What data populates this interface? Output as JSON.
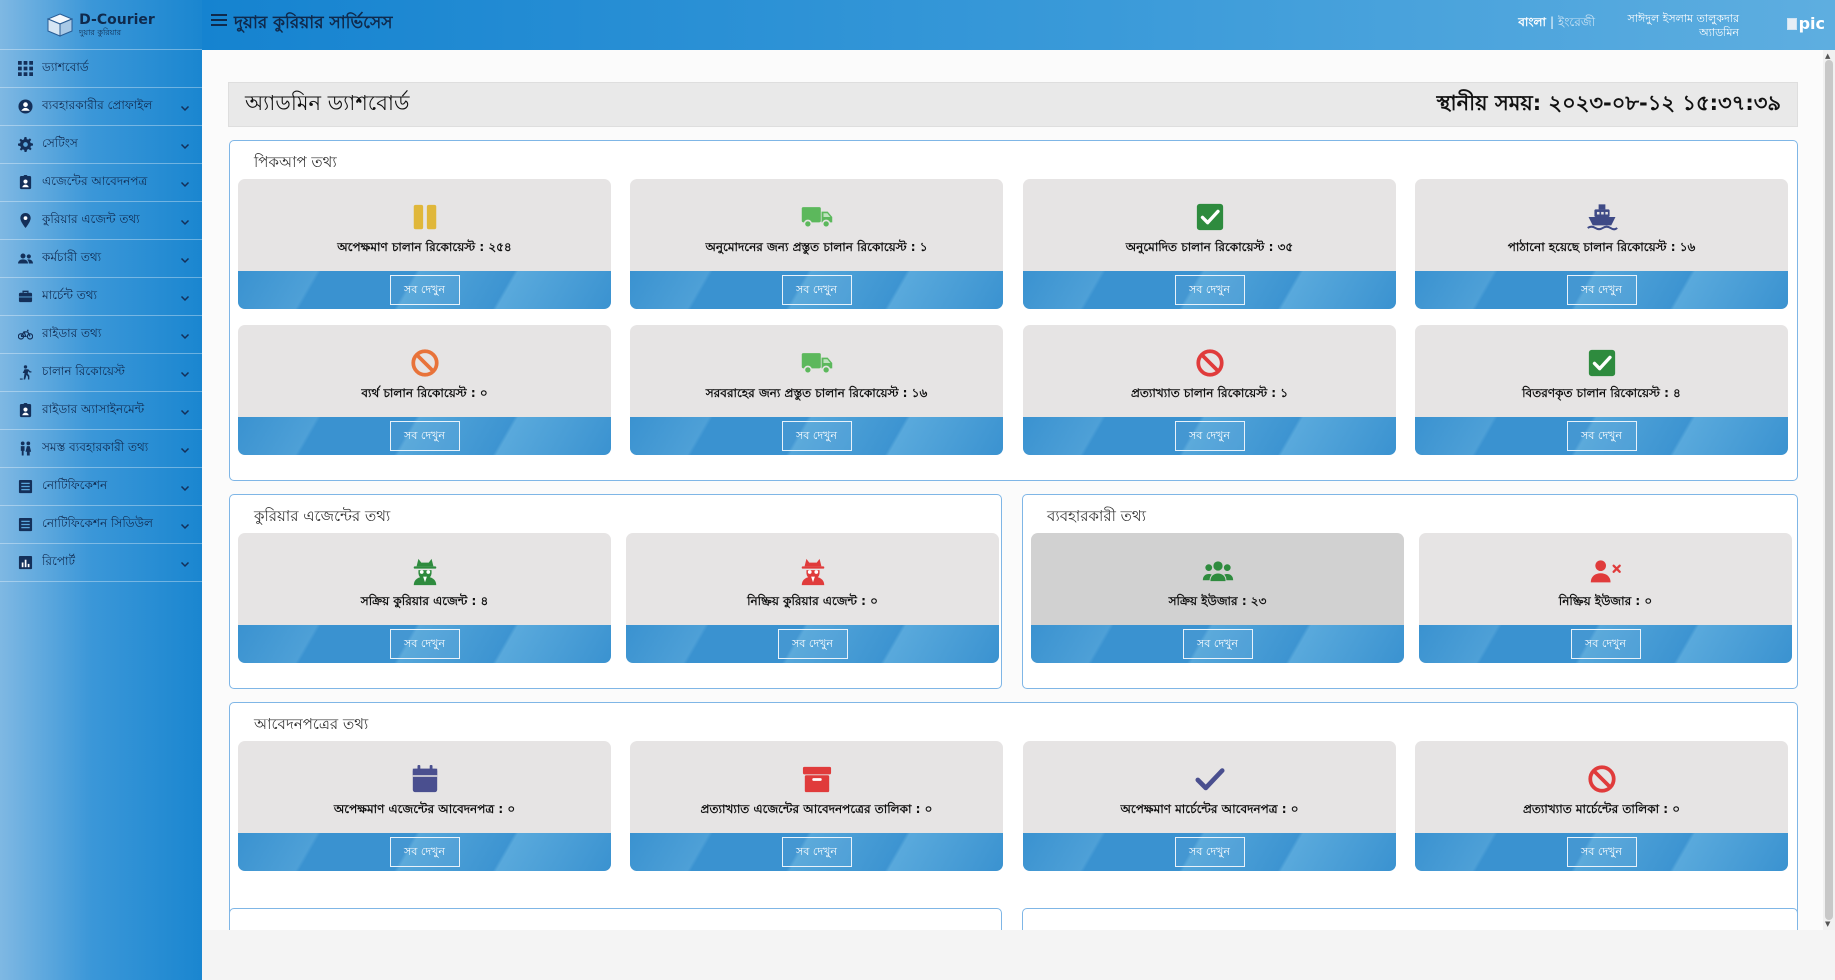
{
  "app": {
    "logo_title": "D-Courier",
    "logo_subtitle": "দুয়ার কুরিয়ার",
    "title": "দুয়ার কুরিয়ার সার্ভিসেস"
  },
  "header": {
    "lang_bn": "বাংলা",
    "lang_sep": "|",
    "lang_en": "ইংরেজী",
    "user_name": "সাঈদুল ইসলাম তালুকদার",
    "user_role": "অ্যাডমিন",
    "user_pic_alt": "pic"
  },
  "sidebar": {
    "items": [
      {
        "label": "ড্যাশবোর্ড",
        "icon": "grid-icon",
        "expandable": false
      },
      {
        "label": "ব্যবহারকারীর প্রোফাইল",
        "icon": "user-circle-icon",
        "expandable": true
      },
      {
        "label": "সেটিংস",
        "icon": "gear-icon",
        "expandable": true
      },
      {
        "label": "এজেন্টের আবেদনপত্র",
        "icon": "id-badge-icon",
        "expandable": true
      },
      {
        "label": "কুরিয়ার এজেন্ট তথ্য",
        "icon": "map-pin-icon",
        "expandable": true
      },
      {
        "label": "কর্মচারী তথ্য",
        "icon": "users-icon",
        "expandable": true
      },
      {
        "label": "মার্চেন্ট তথ্য",
        "icon": "briefcase-icon",
        "expandable": true
      },
      {
        "label": "রাইডার তথ্য",
        "icon": "bicycle-icon",
        "expandable": true
      },
      {
        "label": "চালান রিকোয়েস্ট",
        "icon": "walking-person-icon",
        "expandable": true
      },
      {
        "label": "রাইডার অ্যাসাইনমেন্ট",
        "icon": "id-badge-icon",
        "expandable": true
      },
      {
        "label": "সমস্ত ব্যবহারকারী তথ্য",
        "icon": "people-icon",
        "expandable": true
      },
      {
        "label": "নোটিফিকেশন",
        "icon": "list-icon",
        "expandable": true
      },
      {
        "label": "নোটিফিকেশন সিডিউল",
        "icon": "list-icon",
        "expandable": true
      },
      {
        "label": "রিপোর্ট",
        "icon": "bar-chart-icon",
        "expandable": true
      }
    ]
  },
  "page": {
    "title": "অ্যাডমিন ড্যাশবোর্ড",
    "local_time": "স্থানীয় সময়: ২০২৩-০৮-১২ ১৫:৩৭:৩৯"
  },
  "view_all_label": "সব দেখুন",
  "pickup": {
    "title": "পিকআপ তথ্য",
    "cards": [
      {
        "label": "অপেক্ষমাণ চালান রিকোয়েস্ট : ২৫৪",
        "icon": "pause-icon",
        "color": "#e0b73a"
      },
      {
        "label": "অনুমোদনের জন্য প্রস্তুত চালান রিকোয়েস্ট : ১",
        "icon": "truck-icon",
        "color": "#5cb85c"
      },
      {
        "label": "অনুমোদিত চালান রিকোয়েস্ট : ৩৫",
        "icon": "check-square-icon",
        "color": "#2e8b3e"
      },
      {
        "label": "পাঠানো হয়েছে চালান রিকোয়েস্ট : ১৬",
        "icon": "ship-icon",
        "color": "#3f4a86"
      },
      {
        "label": "ব্যর্থ চালান রিকোয়েস্ট : ০",
        "icon": "ban-icon",
        "color": "#e8733a"
      },
      {
        "label": "সরবরাহের জন্য প্রস্তুত চালান রিকোয়েস্ট : ১৬",
        "icon": "truck-icon",
        "color": "#5cb85c"
      },
      {
        "label": "প্রত্যাখ্যাত চালান রিকোয়েস্ট : ১",
        "icon": "ban-icon",
        "color": "#e03b3b"
      },
      {
        "label": "বিতরণকৃত চালান রিকোয়েস্ট : ৪",
        "icon": "check-square-icon",
        "color": "#2e8b3e"
      }
    ]
  },
  "agents": {
    "title": "কুরিয়ার এজেন্টের তথ্য",
    "cards": [
      {
        "label": "সক্রিয় কুরিয়ার এজেন্ট : ৪",
        "icon": "spy-icon",
        "color": "#2e8b3e"
      },
      {
        "label": "নিষ্ক্রিয় কুরিয়ার এজেন্ট : ০",
        "icon": "spy-icon",
        "color": "#e03b3b"
      }
    ]
  },
  "users": {
    "title": "ব্যবহারকারী তথ্য",
    "cards": [
      {
        "label": "সক্রিয় ইউজার : ২৩",
        "icon": "users-group-icon",
        "color": "#2e8b3e"
      },
      {
        "label": "নিষ্ক্রিয় ইউজার : ০",
        "icon": "user-x-icon",
        "color": "#e03b3b"
      }
    ]
  },
  "applications": {
    "title": "আবেদনপত্রের তথ্য",
    "cards": [
      {
        "label": "অপেক্ষমাণ এজেন্টের আবেদনপত্র : ০",
        "icon": "calendar-icon",
        "color": "#4a4f8f"
      },
      {
        "label": "প্রত্যাখ্যাত এজেন্টের আবেদনপত্রের তালিকা : ০",
        "icon": "archive-icon",
        "color": "#e03b3b"
      },
      {
        "label": "অপেক্ষমাণ মার্চেন্টের আবেদনপত্র : ০",
        "icon": "check-icon",
        "color": "#4a4f8f"
      },
      {
        "label": "প্রত্যাখ্যাত মার্চেন্টের তালিকা : ০",
        "icon": "ban-icon",
        "color": "#e03b3b"
      }
    ]
  }
}
